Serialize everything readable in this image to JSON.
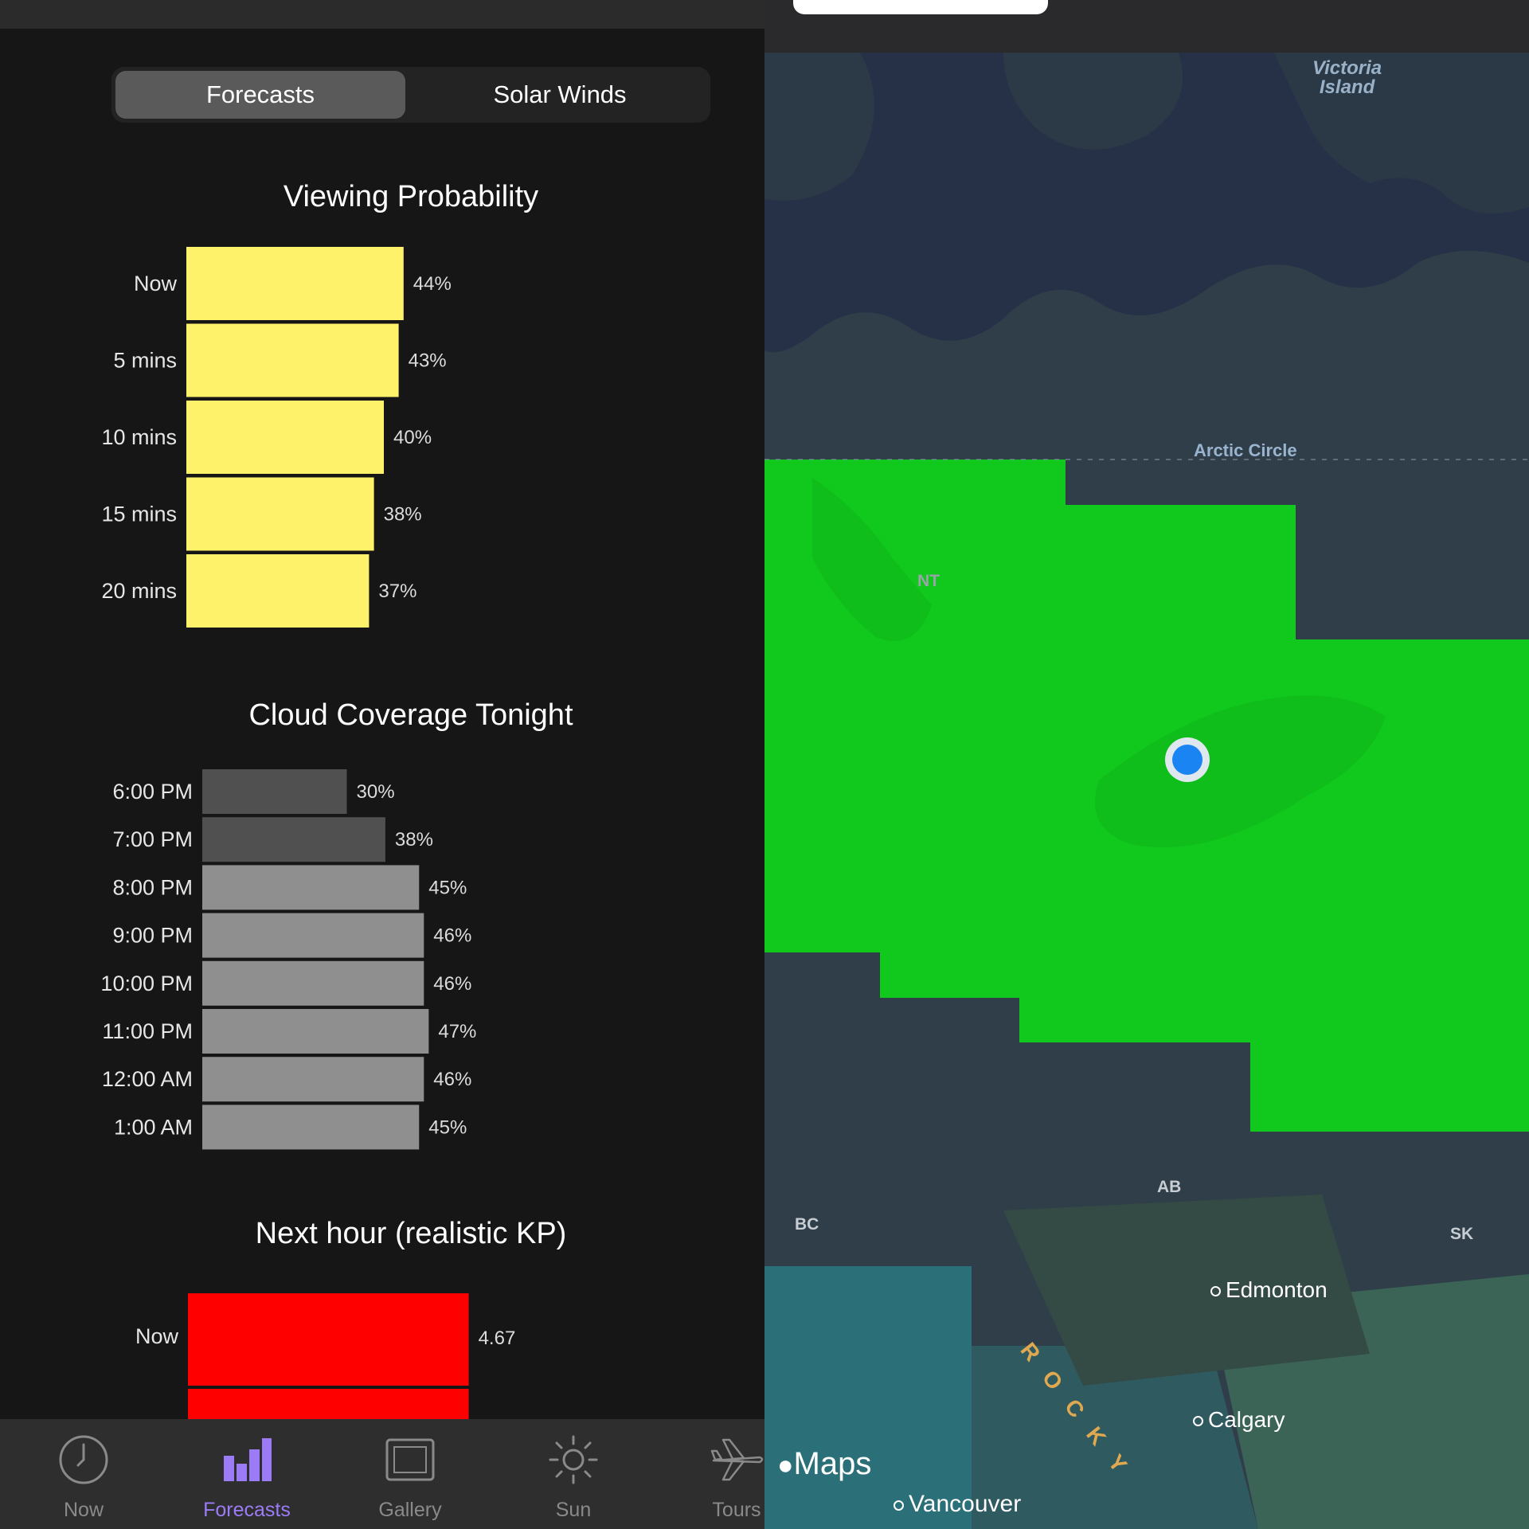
{
  "segmented": {
    "active": "Forecasts",
    "inactive": "Solar Winds"
  },
  "sections": {
    "viewing": {
      "title": "Viewing Probability",
      "color": "#fef26a",
      "rows": [
        {
          "label": "Now",
          "value": 44,
          "display": "44%"
        },
        {
          "label": "5 mins",
          "value": 43,
          "display": "43%"
        },
        {
          "label": "10 mins",
          "value": 40,
          "display": "40%"
        },
        {
          "label": "15 mins",
          "value": 38,
          "display": "38%"
        },
        {
          "label": "20 mins",
          "value": 37,
          "display": "37%"
        }
      ]
    },
    "cloud": {
      "title": "Cloud Coverage Tonight",
      "rows": [
        {
          "label": "6:00 PM",
          "value": 30,
          "display": "30%",
          "color": "#505050"
        },
        {
          "label": "7:00 PM",
          "value": 38,
          "display": "38%",
          "color": "#505050"
        },
        {
          "label": "8:00 PM",
          "value": 45,
          "display": "45%",
          "color": "#8f8f8f"
        },
        {
          "label": "9:00 PM",
          "value": 46,
          "display": "46%",
          "color": "#8f8f8f"
        },
        {
          "label": "10:00 PM",
          "value": 46,
          "display": "46%",
          "color": "#8f8f8f"
        },
        {
          "label": "11:00 PM",
          "value": 47,
          "display": "47%",
          "color": "#8f8f8f"
        },
        {
          "label": "12:00 AM",
          "value": 46,
          "display": "46%",
          "color": "#8f8f8f"
        },
        {
          "label": "1:00 AM",
          "value": 45,
          "display": "45%",
          "color": "#8f8f8f"
        }
      ]
    },
    "kp": {
      "title": "Next hour (realistic KP)",
      "color": "#ff0000",
      "rows": [
        {
          "label": "Now",
          "value": 4.67,
          "display": "4.67"
        }
      ]
    }
  },
  "tabbar": {
    "active_color": "#9b7cf6",
    "tabs": [
      {
        "label": "Now",
        "icon": "clock-icon",
        "active": false
      },
      {
        "label": "Forecasts",
        "icon": "bar-chart-icon",
        "active": true
      },
      {
        "label": "Gallery",
        "icon": "picture-frame-icon",
        "active": false
      },
      {
        "label": "Sun",
        "icon": "sun-icon",
        "active": false
      },
      {
        "label": "Tours",
        "icon": "airplane-icon",
        "active": false
      }
    ]
  },
  "map": {
    "aurora_color": "#10c91c",
    "labels": {
      "victoria_island": "Victoria\nIsland",
      "arctic_circle": "Arctic Circle",
      "nt": "NT",
      "ab": "AB",
      "bc": "BC",
      "sk": "SK",
      "edmonton": "Edmonton",
      "calgary": "Calgary",
      "vancouver": "Vancouver",
      "rocky": "ROCKY"
    },
    "attribution": "Maps"
  }
}
